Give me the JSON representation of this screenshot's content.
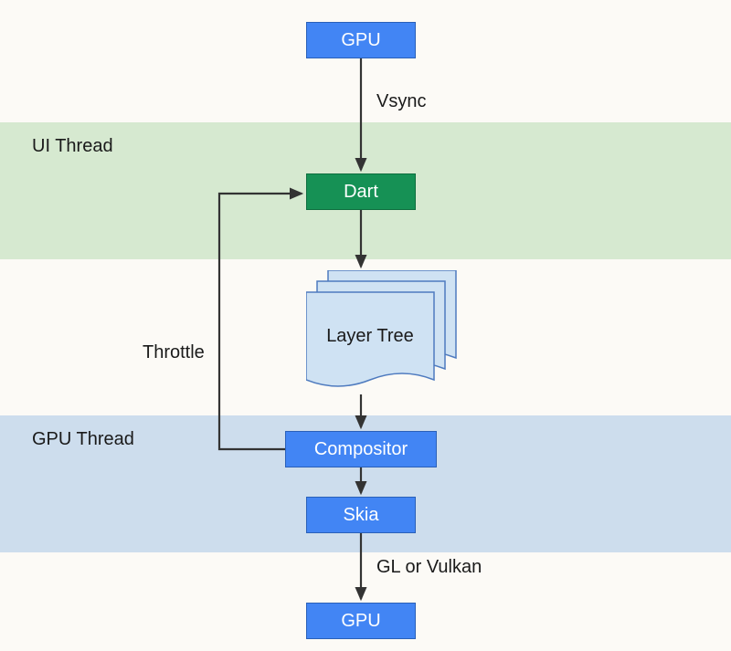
{
  "bands": {
    "ui_label": "UI Thread",
    "gpu_label": "GPU Thread"
  },
  "nodes": {
    "gpu_top": "GPU",
    "dart": "Dart",
    "layer_tree": "Layer Tree",
    "compositor": "Compositor",
    "skia": "Skia",
    "gpu_bottom": "GPU"
  },
  "edge_labels": {
    "vsync": "Vsync",
    "throttle": "Throttle",
    "gl_vulkan": "GL or Vulkan"
  },
  "colors": {
    "blue": "#4285f4",
    "green": "#169155",
    "ui_band": "#d6e9d0",
    "gpu_band": "#cddded",
    "page_fill": "#cfe2f3",
    "page_border": "#4f7bbf",
    "arrow": "#333333"
  }
}
